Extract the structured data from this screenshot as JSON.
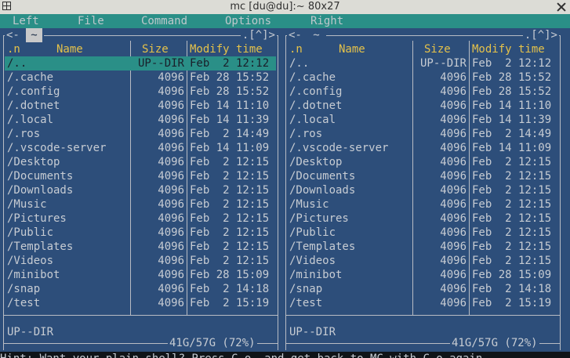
{
  "window": {
    "title": "mc [du@du]:~ 80x27"
  },
  "menubar": {
    "items": [
      {
        "label": "Left"
      },
      {
        "label": "File"
      },
      {
        "label": "Command"
      },
      {
        "label": "Options"
      },
      {
        "label": "Right"
      }
    ]
  },
  "left_panel": {
    "path": "~",
    "top_left_arrows": "<-",
    "top_right_arrows": ".[^]>",
    "headers": {
      "sort": ".n",
      "name": "Name",
      "size": "Size",
      "modify": "Modify time"
    },
    "rows": [
      {
        "name": "/..",
        "size": "UP--DIR",
        "date": "Feb  2 12:12",
        "selected": true
      },
      {
        "name": "/.cache",
        "size": "4096",
        "date": "Feb 28 15:52"
      },
      {
        "name": "/.config",
        "size": "4096",
        "date": "Feb 28 15:52"
      },
      {
        "name": "/.dotnet",
        "size": "4096",
        "date": "Feb 14 11:10"
      },
      {
        "name": "/.local",
        "size": "4096",
        "date": "Feb 14 11:39"
      },
      {
        "name": "/.ros",
        "size": "4096",
        "date": "Feb  2 14:49"
      },
      {
        "name": "/.vscode-server",
        "size": "4096",
        "date": "Feb 14 11:09"
      },
      {
        "name": "/Desktop",
        "size": "4096",
        "date": "Feb  2 12:15"
      },
      {
        "name": "/Documents",
        "size": "4096",
        "date": "Feb  2 12:15"
      },
      {
        "name": "/Downloads",
        "size": "4096",
        "date": "Feb  2 12:15"
      },
      {
        "name": "/Music",
        "size": "4096",
        "date": "Feb  2 12:15"
      },
      {
        "name": "/Pictures",
        "size": "4096",
        "date": "Feb  2 12:15"
      },
      {
        "name": "/Public",
        "size": "4096",
        "date": "Feb  2 12:15"
      },
      {
        "name": "/Templates",
        "size": "4096",
        "date": "Feb  2 12:15"
      },
      {
        "name": "/Videos",
        "size": "4096",
        "date": "Feb  2 12:15"
      },
      {
        "name": "/minibot",
        "size": "4096",
        "date": "Feb 28 15:09"
      },
      {
        "name": "/snap",
        "size": "4096",
        "date": "Feb  2 14:18"
      },
      {
        "name": "/test",
        "size": "4096",
        "date": "Feb  2 15:19"
      }
    ],
    "status": "UP--DIR",
    "disk": "41G/57G (72%)"
  },
  "right_panel": {
    "path": "~",
    "top_left_arrows": "<-",
    "top_right_arrows": ".[^]>",
    "headers": {
      "sort": ".n",
      "name": "Name",
      "size": "Size",
      "modify": "Modify time"
    },
    "rows": [
      {
        "name": "/..",
        "size": "UP--DIR",
        "date": "Feb  2 12:12"
      },
      {
        "name": "/.cache",
        "size": "4096",
        "date": "Feb 28 15:52"
      },
      {
        "name": "/.config",
        "size": "4096",
        "date": "Feb 28 15:52"
      },
      {
        "name": "/.dotnet",
        "size": "4096",
        "date": "Feb 14 11:10"
      },
      {
        "name": "/.local",
        "size": "4096",
        "date": "Feb 14 11:39"
      },
      {
        "name": "/.ros",
        "size": "4096",
        "date": "Feb  2 14:49"
      },
      {
        "name": "/.vscode-server",
        "size": "4096",
        "date": "Feb 14 11:09"
      },
      {
        "name": "/Desktop",
        "size": "4096",
        "date": "Feb  2 12:15"
      },
      {
        "name": "/Documents",
        "size": "4096",
        "date": "Feb  2 12:15"
      },
      {
        "name": "/Downloads",
        "size": "4096",
        "date": "Feb  2 12:15"
      },
      {
        "name": "/Music",
        "size": "4096",
        "date": "Feb  2 12:15"
      },
      {
        "name": "/Pictures",
        "size": "4096",
        "date": "Feb  2 12:15"
      },
      {
        "name": "/Public",
        "size": "4096",
        "date": "Feb  2 12:15"
      },
      {
        "name": "/Templates",
        "size": "4096",
        "date": "Feb  2 12:15"
      },
      {
        "name": "/Videos",
        "size": "4096",
        "date": "Feb  2 12:15"
      },
      {
        "name": "/minibot",
        "size": "4096",
        "date": "Feb 28 15:09"
      },
      {
        "name": "/snap",
        "size": "4096",
        "date": "Feb  2 14:18"
      },
      {
        "name": "/test",
        "size": "4096",
        "date": "Feb  2 15:19"
      }
    ],
    "status": "UP--DIR",
    "disk": "41G/57G (72%)"
  },
  "hint": "Hint: Want your plain shell? Press C-o, and get back to MC with C-o again."
}
